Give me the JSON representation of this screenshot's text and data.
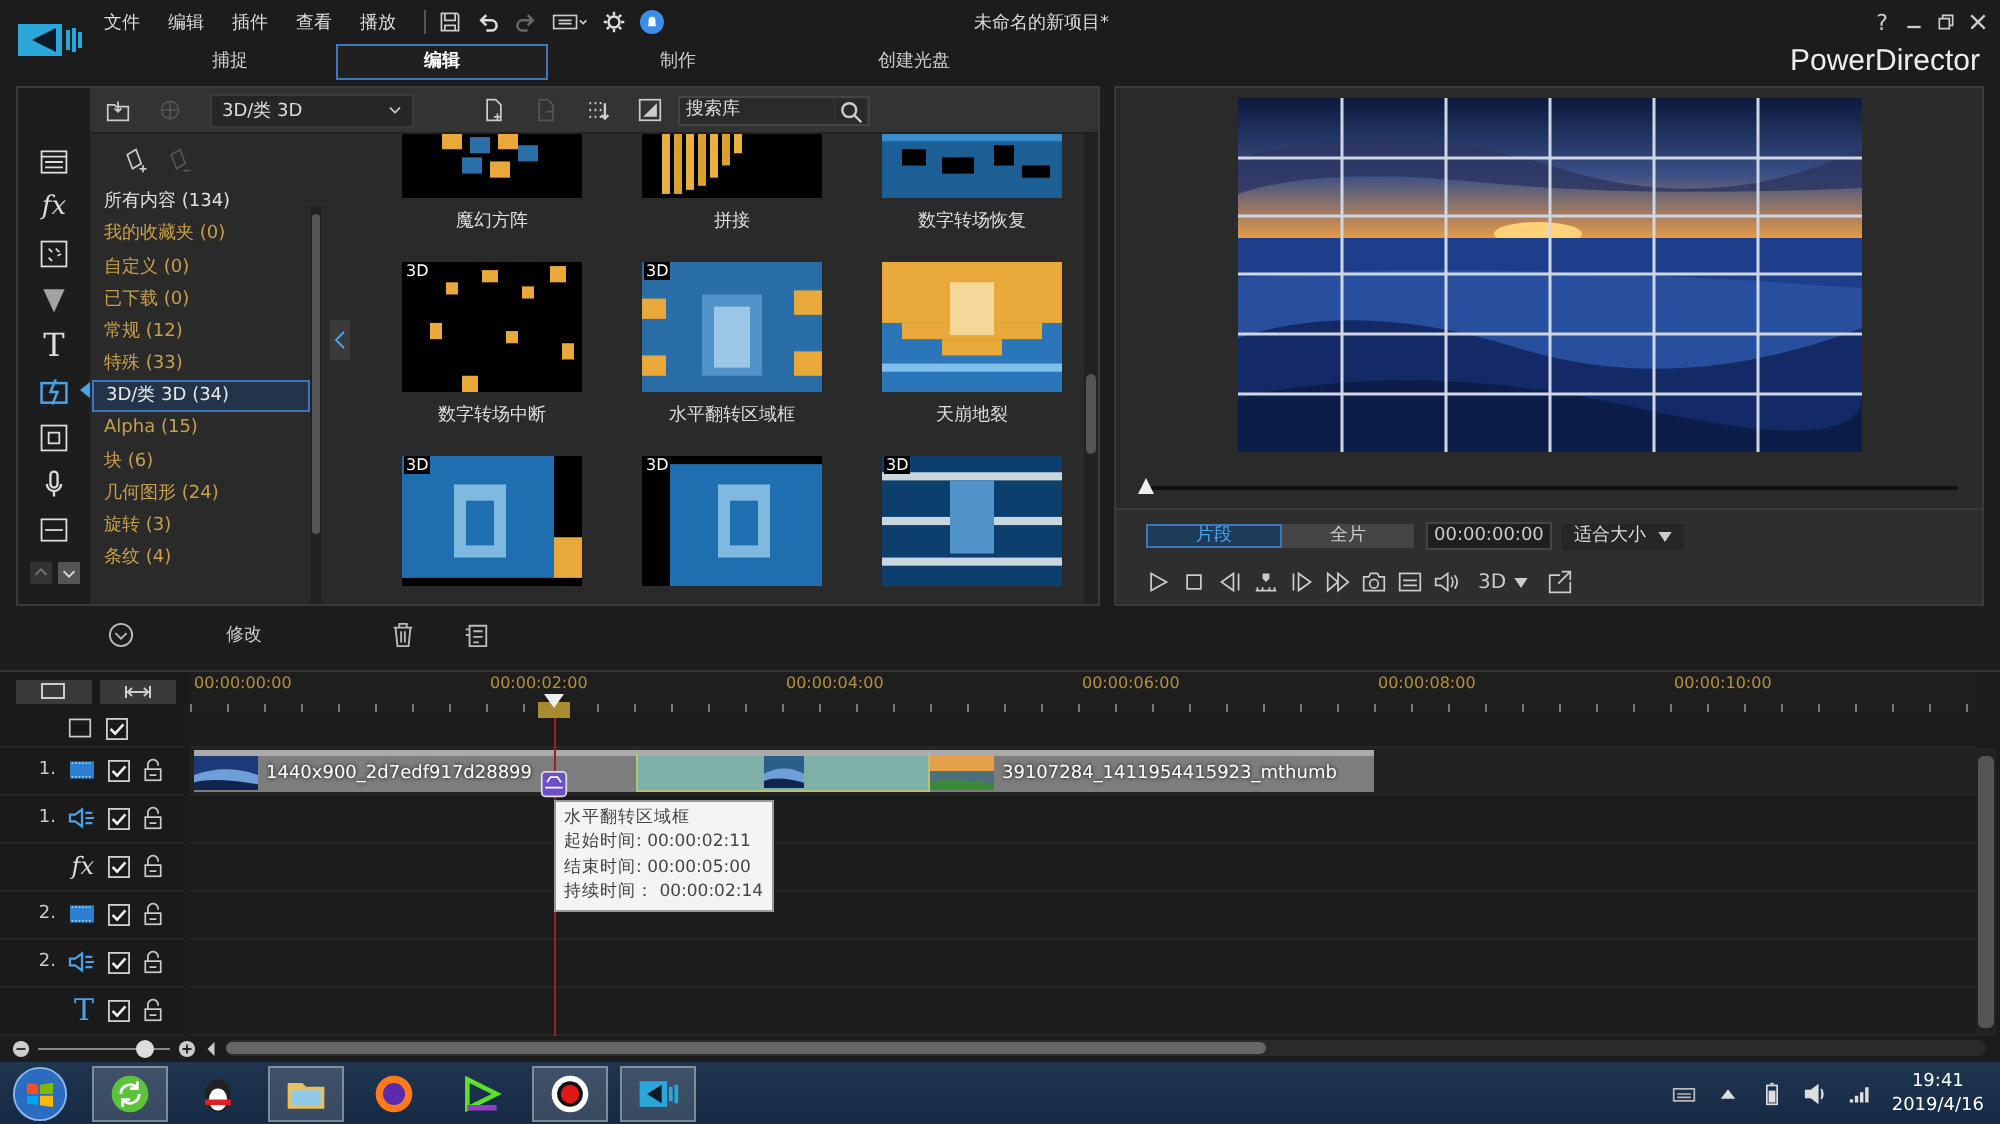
{
  "app": {
    "menus": [
      "文件",
      "编辑",
      "插件",
      "查看",
      "播放"
    ],
    "title": "未命名的新项目*",
    "help": "?",
    "brand": "PowerDirector"
  },
  "tabs": [
    {
      "label": "捕捉",
      "selected": false
    },
    {
      "label": "编辑",
      "selected": true
    },
    {
      "label": "制作",
      "selected": false
    },
    {
      "label": "创建光盘",
      "selected": false
    }
  ],
  "room_icons": [
    {
      "kind": "media",
      "selected": false
    },
    {
      "kind": "fx",
      "glyph": "fx",
      "selected": false
    },
    {
      "kind": "pip",
      "selected": false
    },
    {
      "kind": "particle",
      "selected": false
    },
    {
      "kind": "title",
      "glyph": "T",
      "selected": false
    },
    {
      "kind": "transition",
      "selected": true
    },
    {
      "kind": "chapter",
      "selected": false
    },
    {
      "kind": "voice",
      "selected": false
    },
    {
      "kind": "subtitle",
      "selected": false
    }
  ],
  "library": {
    "dropdown": "3D/类 3D",
    "search": {
      "placeholder": "搜索库"
    },
    "categories": [
      {
        "label": "所有内容 (134)",
        "kind": "all",
        "selected": false
      },
      {
        "label": "我的收藏夹  (0)",
        "kind": "group",
        "selected": false
      },
      {
        "label": "自定义  (0)",
        "kind": "group",
        "selected": false
      },
      {
        "label": "已下载  (0)",
        "kind": "group",
        "selected": false
      },
      {
        "label": "常规  (12)",
        "kind": "group",
        "selected": false
      },
      {
        "label": "特殊  (33)",
        "kind": "group",
        "selected": false
      },
      {
        "label": "3D/类 3D  (34)",
        "kind": "group",
        "selected": true
      },
      {
        "label": "Alpha  (15)",
        "kind": "group",
        "selected": false
      },
      {
        "label": "块  (6)",
        "kind": "group",
        "selected": false
      },
      {
        "label": "几何图形  (24)",
        "kind": "group",
        "selected": false
      },
      {
        "label": "旋转  (3)",
        "kind": "group",
        "selected": false
      },
      {
        "label": "条纹  (4)",
        "kind": "group",
        "selected": false
      }
    ],
    "thumbnails": [
      {
        "label": "魔幻方阵"
      },
      {
        "label": "拼接"
      },
      {
        "label": "数字转场恢复"
      },
      {
        "label": "数字转场中断",
        "badge": "3D"
      },
      {
        "label": "水平翻转区域框",
        "badge": "3D"
      },
      {
        "label": "天崩地裂"
      },
      {
        "badge": "3D"
      },
      {
        "badge": "3D"
      },
      {
        "badge": "3D"
      }
    ]
  },
  "preview": {
    "level": 0,
    "modes": [
      {
        "label": "片段",
        "selected": true
      },
      {
        "label": "全片",
        "selected": false
      }
    ],
    "timecode": "00:00:00:00",
    "fit": "适合大小",
    "stereo": "3D"
  },
  "edit_toolbar": {
    "modify": "修改"
  },
  "timeline": {
    "ruler": [
      "00:00:00:00",
      "00:00:02:00",
      "00:00:04:00",
      "00:00:06:00",
      "00:00:08:00",
      "00:00:10:00"
    ],
    "tracks": [
      {
        "kind": "master",
        "checked": true
      },
      {
        "number": "1.",
        "kind": "video",
        "checked": true,
        "locked": false
      },
      {
        "number": "1.",
        "kind": "audio",
        "checked": true,
        "locked": false
      },
      {
        "kind": "fx",
        "glyph": "fx",
        "checked": true,
        "locked": false
      },
      {
        "number": "2.",
        "kind": "video",
        "checked": true,
        "locked": false
      },
      {
        "number": "2.",
        "kind": "audio",
        "checked": true,
        "locked": false
      },
      {
        "kind": "title",
        "glyph": "T",
        "checked": true,
        "locked": false
      }
    ],
    "clips": [
      {
        "kind": "video",
        "label": "1440x900_2d7edf917d28899"
      },
      {
        "kind": "transition"
      },
      {
        "kind": "video",
        "label": "39107284_1411954415923_mthumb"
      }
    ],
    "tooltip": {
      "title": "水平翻转区域框",
      "lines": [
        "起始时间: 00:00:02:11",
        "结束时间: 00:00:05:00",
        "持续时间： 00:00:02:14"
      ]
    },
    "zoom": {
      "level": 0.8
    }
  },
  "taskbar": {
    "apps": [
      {
        "kind": "refresh",
        "active": true
      },
      {
        "kind": "chat",
        "active": false
      },
      {
        "kind": "folder",
        "active": true
      },
      {
        "kind": "browser",
        "active": false
      },
      {
        "kind": "media",
        "active": false
      },
      {
        "kind": "record",
        "active": true
      },
      {
        "kind": "editor",
        "active": true
      }
    ],
    "time": "19:41",
    "date": "2019/4/16"
  }
}
